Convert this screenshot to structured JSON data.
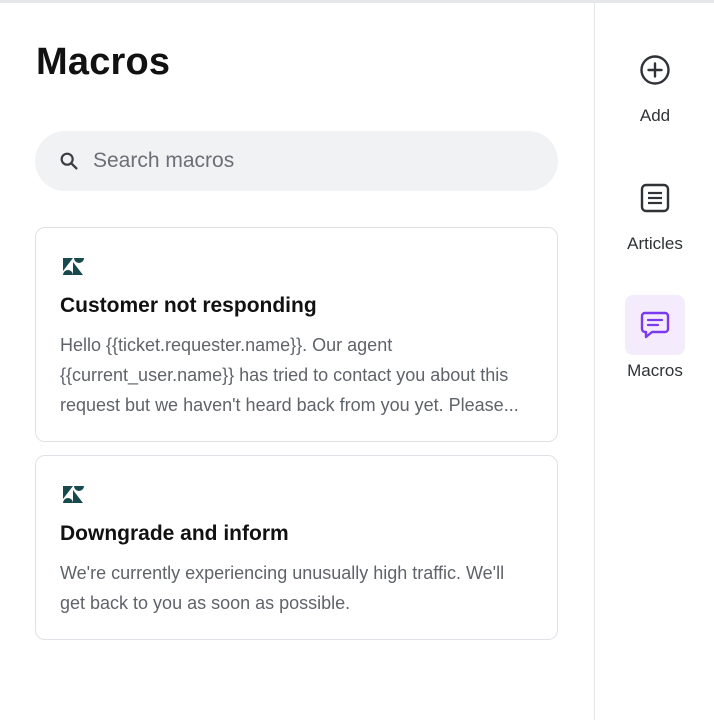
{
  "header": {
    "title": "Macros"
  },
  "search": {
    "placeholder": "Search macros"
  },
  "macros": [
    {
      "title": "Customer not responding",
      "body": "Hello {{ticket.requester.name}}. Our agent {{current_user.name}} has tried to contact you about this request but we haven't heard back from you yet. Please..."
    },
    {
      "title": "Downgrade and inform",
      "body": "We're currently experiencing unusually high traffic. We'll get back to you as soon as possible."
    }
  ],
  "sidebar": {
    "items": [
      {
        "label": "Add",
        "icon": "plus-circle-icon"
      },
      {
        "label": "Articles",
        "icon": "article-icon"
      },
      {
        "label": "Macros",
        "icon": "chat-message-icon",
        "active": true
      }
    ]
  },
  "colors": {
    "accent": "#7c3aed",
    "accent_bg": "#f4ecfd",
    "brand": "#17494d"
  }
}
